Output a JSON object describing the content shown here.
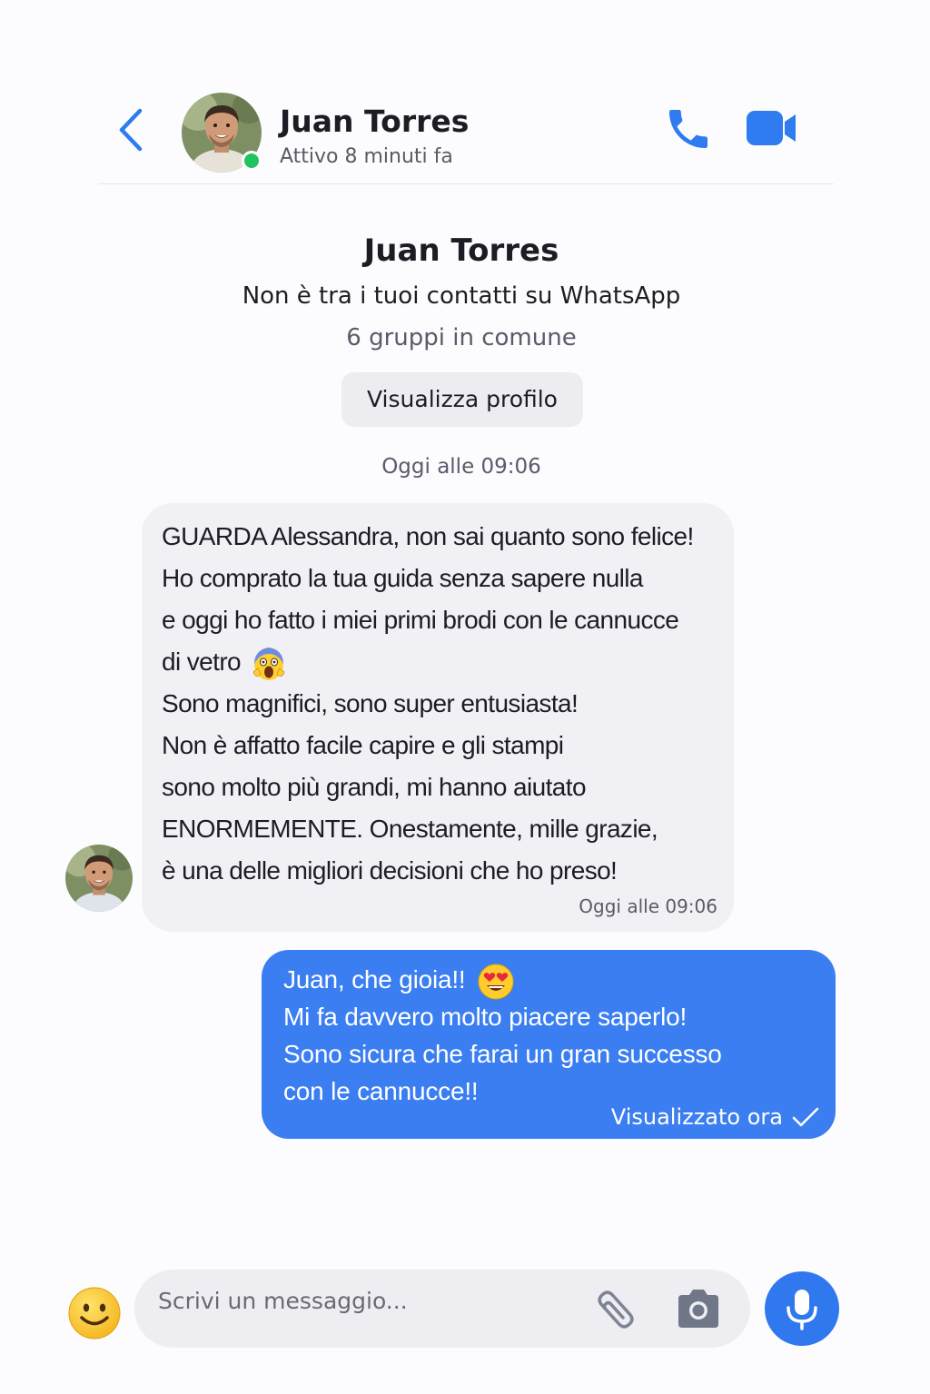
{
  "header": {
    "contact_name": "Juan Torres",
    "status": "Attivo 8 minuti fa",
    "icons": {
      "back": "chevron-left-icon",
      "call": "phone-icon",
      "video": "video-camera-icon"
    },
    "accent_color": "#2f7bf0",
    "online_color": "#22c35e"
  },
  "contact_info": {
    "name": "Juan Torres",
    "note": "Non è tra i tuoi contatti su WhatsApp",
    "groups": "6 gruppi in comune",
    "view_profile_label": "Visualizza profilo"
  },
  "chat": {
    "date_divider": "Oggi alle 09:06",
    "incoming": {
      "lines": [
        "GUARDA Alessandra, non sai quanto sono felice!",
        "Ho comprato la tua guida senza sapere nulla",
        "e oggi ho fatto i miei primi brodi con le cannucce",
        "di vetro",
        "Sono magnifici, sono super entusiasta!",
        "Non è affatto facile capire e gli stampi",
        "sono molto più grandi, mi hanno aiutato",
        "ENORMEMENTE. Onestamente, mille grazie,",
        "è una delle migliori decisioni che ho preso!"
      ],
      "emoji": "screaming-face-emoji",
      "timestamp": "Oggi alle 09:06",
      "bubble_color": "#f1f1f5"
    },
    "outgoing": {
      "lines": [
        "Juan, che gioia!!",
        "Mi fa davvero molto piacere saperlo!",
        "Sono sicura che farai un gran successo",
        "con le cannucce!!"
      ],
      "emoji": "heart-eyes-emoji",
      "status": "Visualizzato ora",
      "status_icon": "checkmark-icon",
      "bubble_color": "#3a7ef1"
    }
  },
  "composer": {
    "placeholder": "Scrivi un messaggio...",
    "value": "",
    "icons": {
      "emoji": "smiley-face-icon",
      "attach": "paperclip-icon",
      "camera": "camera-icon",
      "mic": "microphone-icon"
    }
  }
}
